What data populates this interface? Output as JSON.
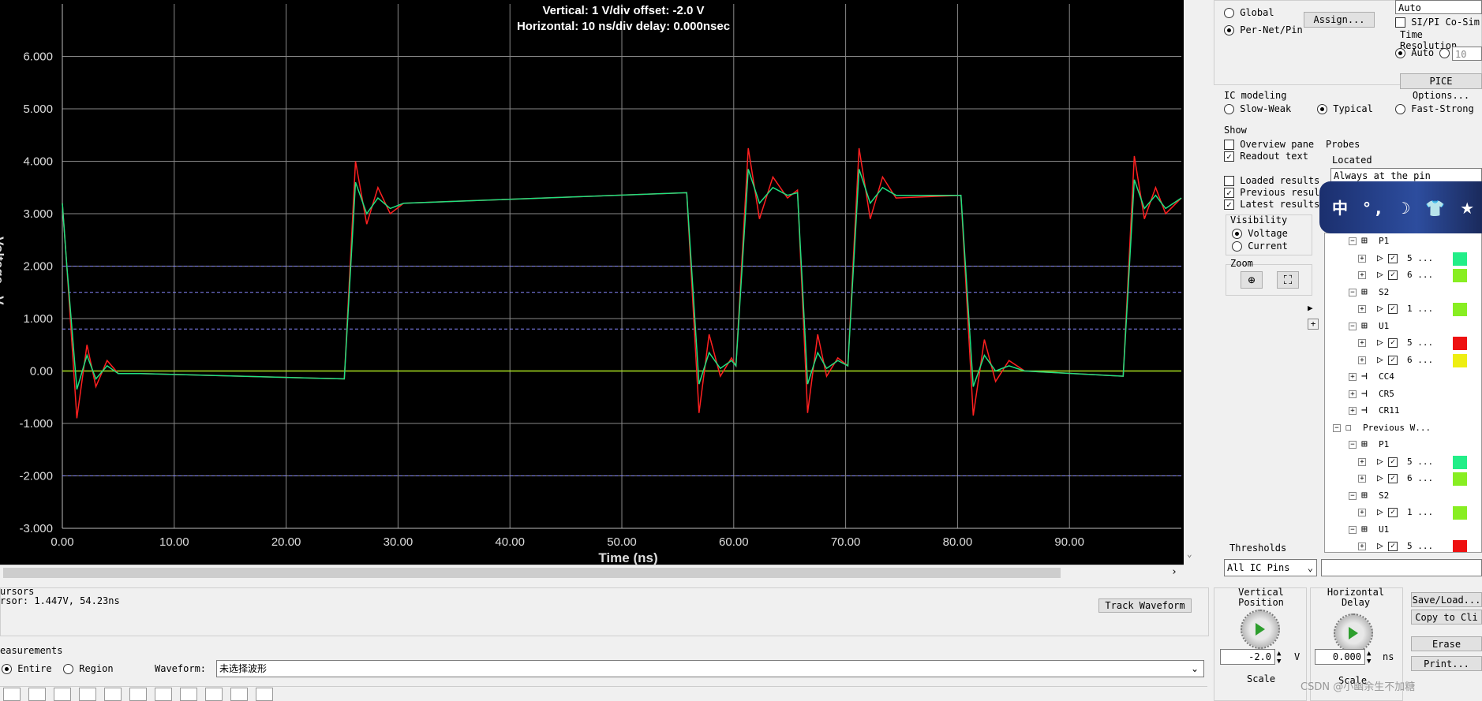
{
  "scope": {
    "header_vertical": "Vertical: 1  V/div  offset: -2.0 V",
    "header_horizontal": "Horizontal: 10 ns/div  delay: 0.000nsec",
    "y_label": "Voltage  - V-",
    "x_label": "Time  (ns)"
  },
  "chart_data": {
    "type": "line",
    "x_ticks": [
      "0.00",
      "10.00",
      "20.00",
      "30.00",
      "40.00",
      "50.00",
      "60.00",
      "70.00",
      "80.00",
      "90.00"
    ],
    "y_ticks": [
      "6.000",
      "5.000",
      "4.000",
      "3.000",
      "2.000",
      "1.000",
      "0.00",
      "-1.000",
      "-2.000",
      "-3.000"
    ],
    "xlim": [
      0,
      100
    ],
    "ylim": [
      -3,
      7
    ],
    "thresholds": [
      2.0,
      1.5,
      0.8,
      -2.0
    ],
    "series": [
      {
        "color": "#ff2020",
        "x": [
          0,
          0.4,
          1.3,
          2.2,
          3.0,
          4.0,
          5.0,
          7.0,
          25.2,
          26.2,
          27.2,
          28.2,
          29.3,
          30.5,
          55.8,
          56.9,
          57.8,
          58.8,
          59.8,
          60.2,
          61.3,
          62.3,
          63.5,
          64.8,
          65.7,
          66.6,
          67.5,
          68.3,
          69.3,
          70.2,
          71.2,
          72.2,
          73.3,
          74.5,
          80.3,
          81.4,
          82.4,
          83.4,
          84.6,
          86,
          94.8,
          95.8,
          96.7,
          97.7,
          98.6,
          100
        ],
        "y": [
          3.2,
          2.0,
          -0.9,
          0.5,
          -0.3,
          0.2,
          -0.05,
          -0.05,
          -0.15,
          4.0,
          2.8,
          3.5,
          3.0,
          3.2,
          3.4,
          -0.8,
          0.7,
          -0.1,
          0.25,
          0.1,
          4.25,
          2.9,
          3.7,
          3.3,
          3.45,
          -0.8,
          0.7,
          -0.1,
          0.25,
          0.1,
          4.25,
          2.9,
          3.7,
          3.3,
          3.35,
          -0.85,
          0.6,
          -0.2,
          0.2,
          0,
          -0.1,
          4.1,
          2.9,
          3.5,
          3.0,
          3.3
        ]
      },
      {
        "color": "#20e080",
        "x": [
          0,
          0.4,
          1.3,
          2.2,
          3.0,
          4.0,
          5.0,
          7.0,
          25.2,
          26.2,
          27.2,
          28.2,
          29.3,
          30.5,
          55.8,
          56.9,
          57.8,
          58.8,
          59.8,
          60.2,
          61.3,
          62.3,
          63.5,
          64.8,
          65.7,
          66.6,
          67.5,
          68.3,
          69.3,
          70.2,
          71.2,
          72.2,
          73.3,
          74.5,
          80.3,
          81.4,
          82.4,
          83.4,
          84.6,
          86,
          94.8,
          95.8,
          96.7,
          97.7,
          98.6,
          100
        ],
        "y": [
          3.2,
          2.0,
          -0.35,
          0.3,
          -0.15,
          0.1,
          -0.05,
          -0.05,
          -0.15,
          3.6,
          3.0,
          3.3,
          3.1,
          3.2,
          3.4,
          -0.25,
          0.35,
          0.05,
          0.2,
          0.1,
          3.85,
          3.2,
          3.5,
          3.35,
          3.4,
          -0.25,
          0.35,
          0.05,
          0.2,
          0.1,
          3.85,
          3.2,
          3.5,
          3.35,
          3.35,
          -0.3,
          0.3,
          0.0,
          0.1,
          0,
          -0.1,
          3.65,
          3.1,
          3.35,
          3.1,
          3.3
        ]
      }
    ]
  },
  "right_panel": {
    "global": "Global",
    "per_net": "Per-Net/Pin",
    "assign": "Assign...",
    "auto_dropdown": "Auto",
    "si_pi": "SI/PI Co-Sim",
    "time_resolution": "Time Resolution",
    "auto": "Auto",
    "res_value": "10",
    "spice_options": "PICE Options...",
    "ic_modeling": "IC modeling",
    "slow_weak": "Slow-Weak",
    "typical": "Typical",
    "fast_strong": "Fast-Strong",
    "show": "Show",
    "overview_pane": "Overview pane",
    "readout_text": "Readout text",
    "loaded_results": "Loaded results",
    "previous_results": "Previous resul",
    "latest_results": "Latest results",
    "probes": "Probes",
    "located": "Located",
    "located_value": "Always at the pin",
    "visibility": "Visibility",
    "voltage": "Voltage",
    "current": "Current",
    "zoom": "Zoom",
    "thresholds": "Thresholds",
    "thresholds_value": "All IC Pins",
    "ime_text": "中 °, ☽ 👕 ★"
  },
  "tree": [
    {
      "label": "P1",
      "type": "comp",
      "indent": 1
    },
    {
      "label": "5 ...",
      "type": "pin",
      "indent": 2,
      "color": "#22ee88"
    },
    {
      "label": "6 ...",
      "type": "pin",
      "indent": 2,
      "color": "#88ee22"
    },
    {
      "label": "S2",
      "type": "comp",
      "indent": 1
    },
    {
      "label": "1 ...",
      "type": "pin",
      "indent": 2,
      "color": "#88ee22"
    },
    {
      "label": "U1",
      "type": "comp",
      "indent": 1
    },
    {
      "label": "5 ...",
      "type": "pin",
      "indent": 2,
      "color": "#ee1111"
    },
    {
      "label": "6 ...",
      "type": "pin",
      "indent": 2,
      "color": "#eeee11"
    },
    {
      "label": "CC4",
      "type": "part",
      "indent": 1
    },
    {
      "label": "CR5",
      "type": "part",
      "indent": 1
    },
    {
      "label": "CR11",
      "type": "part",
      "indent": 1
    },
    {
      "label": "Previous W...",
      "type": "root",
      "indent": 0
    },
    {
      "label": "P1",
      "type": "comp",
      "indent": 1
    },
    {
      "label": "5 ...",
      "type": "pin",
      "indent": 2,
      "color": "#22ee88"
    },
    {
      "label": "6 ...",
      "type": "pin",
      "indent": 2,
      "color": "#88ee22"
    },
    {
      "label": "S2",
      "type": "comp",
      "indent": 1
    },
    {
      "label": "1 ...",
      "type": "pin",
      "indent": 2,
      "color": "#88ee22"
    },
    {
      "label": "U1",
      "type": "comp",
      "indent": 1
    },
    {
      "label": "5 ...",
      "type": "pin",
      "indent": 2,
      "color": "#ee1111"
    }
  ],
  "bottom": {
    "cursors": "ursors",
    "cursor_readout": "rsor: 1.447V, 54.23ns",
    "track_waveform": "Track Waveform",
    "measurements": "easurements",
    "entire": "Entire",
    "region": "Region",
    "waveform_label": "Waveform:",
    "waveform_value": "未选择波形",
    "vertical_position": "Vertical Position",
    "vpos_value": "-2.0",
    "vpos_unit": "V",
    "scale": "Scale",
    "horizontal_delay": "Horizontal Delay",
    "hdelay_value": "0.000",
    "hdelay_unit": "ns",
    "scale2": "Scale",
    "save_load": "Save/Load...",
    "copy_clip": "Copy to Cli",
    "erase": "Erase",
    "print": "Print...",
    "watermark": "CSDN @小幽余生不加糖"
  }
}
